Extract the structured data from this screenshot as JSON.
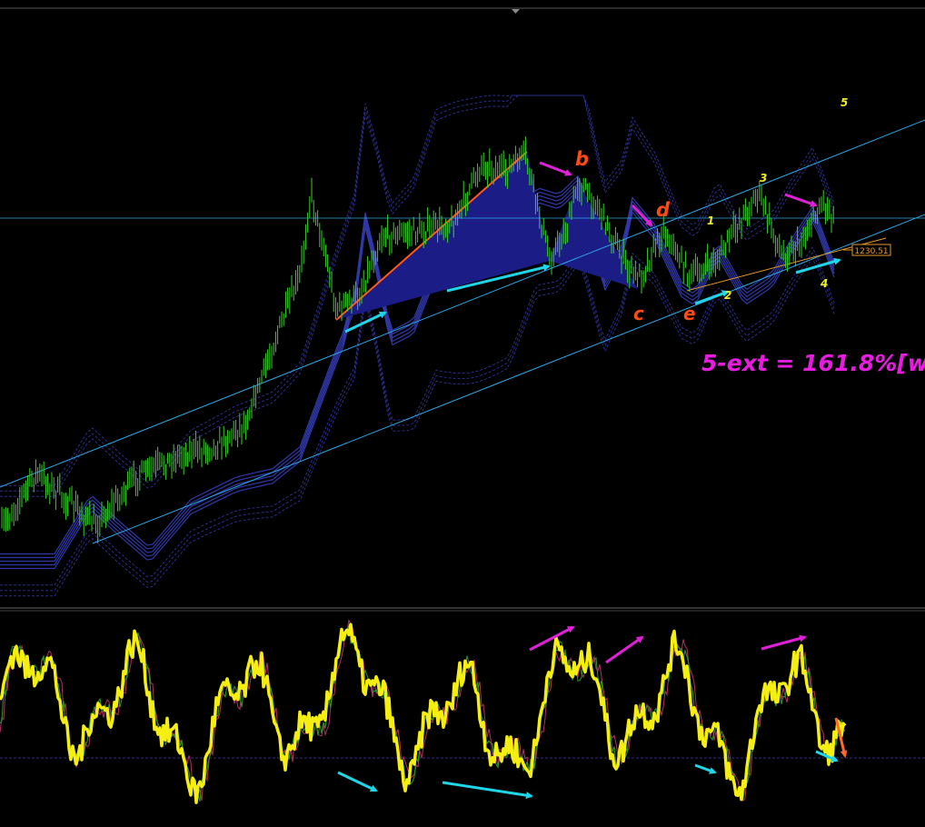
{
  "chart_data": [
    {
      "type": "candlestick",
      "panel": "price",
      "colors": {
        "background": "#000000",
        "candles": "#39d12a",
        "pattern_fill": "#1c1c86",
        "trendline": "#2aa8e6",
        "envelope": "#3038a8",
        "cyan_arrow": "#1fd6e8",
        "magenta_arrow": "#e020d8",
        "wave_label_orange": "#ff4a12",
        "wave_label_yellow": "#f2ee1a",
        "annotation_magenta": "#e81ce0"
      },
      "price_marker": {
        "value": "1230.51"
      },
      "wave_labels": [
        {
          "text": "b",
          "color": "orange"
        },
        {
          "text": "d",
          "color": "orange"
        },
        {
          "text": "c",
          "color": "orange"
        },
        {
          "text": "e",
          "color": "orange"
        },
        {
          "text": "1",
          "color": "yellow"
        },
        {
          "text": "2",
          "color": "yellow"
        },
        {
          "text": "3",
          "color": "yellow"
        },
        {
          "text": "4",
          "color": "yellow"
        },
        {
          "text": "5",
          "color": "yellow"
        }
      ],
      "annotation": "5-ext = 161.8%[w"
    },
    {
      "type": "line",
      "panel": "oscillator",
      "colors": {
        "main_line": "#f4ee12",
        "signal_line_1": "#2f9a2a",
        "signal_line_2": "#b0306a",
        "level_line": "#3a2a88",
        "cyan_arrow": "#1fd6e8",
        "magenta_arrow": "#e020d8",
        "orange_arrow": "#ff6a2a"
      }
    }
  ]
}
